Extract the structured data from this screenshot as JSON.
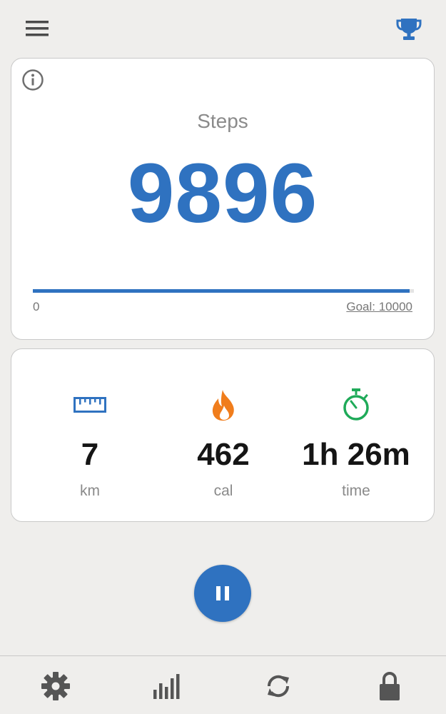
{
  "icons": {
    "menu": "hamburger-menu-icon",
    "trophy": "trophy-icon",
    "info": "info-icon",
    "distance": "ruler-icon",
    "calories": "flame-icon",
    "time": "stopwatch-icon",
    "pause": "pause-icon",
    "settings": "gear-icon",
    "statistics": "bar-chart-icon",
    "reset": "refresh-icon",
    "lock": "lock-icon"
  },
  "colors": {
    "accent": "#2f72c0",
    "distance_icon": "#2f72c0",
    "calories_icon": "#f07d1c",
    "time_icon": "#1faa59",
    "icon_gray": "#555555"
  },
  "steps_card": {
    "label": "Steps",
    "count": "9896",
    "progress_min": "0",
    "progress_goal": "Goal: 10000",
    "progress_fraction": 0.9896
  },
  "stats": {
    "distance": {
      "value": "7",
      "unit": "km"
    },
    "calories": {
      "value": "462",
      "unit": "cal"
    },
    "time": {
      "value": "1h 26m",
      "unit": "time"
    }
  }
}
